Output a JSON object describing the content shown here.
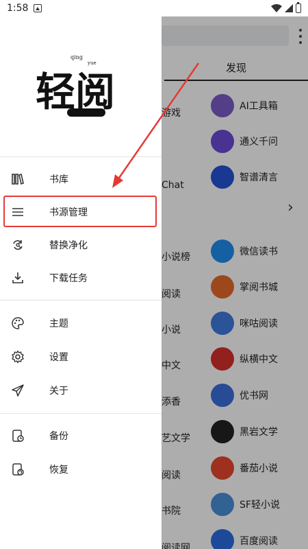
{
  "status_bar": {
    "time": "1:58"
  },
  "drawer": {
    "logo_alt": "轻阅",
    "menu_group_1": [
      {
        "label": "书库",
        "icon": "bookshelf-icon"
      },
      {
        "label": "书源管理",
        "icon": "list-icon"
      },
      {
        "label": "替换净化",
        "icon": "replace-icon"
      },
      {
        "label": "下载任务",
        "icon": "download-icon"
      }
    ],
    "menu_group_2": [
      {
        "label": "主题",
        "icon": "palette-icon"
      },
      {
        "label": "设置",
        "icon": "gear-icon"
      },
      {
        "label": "关于",
        "icon": "send-icon"
      }
    ],
    "menu_group_3": [
      {
        "label": "备份",
        "icon": "backup-icon"
      },
      {
        "label": "恢复",
        "icon": "restore-icon"
      }
    ]
  },
  "background": {
    "tab": "发现",
    "left_partial": [
      "游戏",
      "Chat",
      "小说榜",
      "阅读",
      "小说",
      "中文",
      "添香",
      "艺文学",
      "阅读",
      "书院",
      "阅读网"
    ],
    "right_items": [
      {
        "label": "AI工具箱",
        "color": "#7b5cc7"
      },
      {
        "label": "通义千问",
        "color": "#6a4bd8"
      },
      {
        "label": "智谱清言",
        "color": "#2453d6"
      },
      {
        "label": "微信读书",
        "color": "#1f8ef0"
      },
      {
        "label": "掌阅书城",
        "color": "#e86b2a"
      },
      {
        "label": "咪咕阅读",
        "color": "#3e7be0"
      },
      {
        "label": "纵横中文",
        "color": "#d8302c"
      },
      {
        "label": "优书网",
        "color": "#3c6fdc"
      },
      {
        "label": "黑岩文学",
        "color": "#222222"
      },
      {
        "label": "番茄小说",
        "color": "#e8472f"
      },
      {
        "label": "SF轻小说",
        "color": "#4a90d9"
      },
      {
        "label": "百度阅读",
        "color": "#2b6de0"
      }
    ]
  },
  "colors": {
    "highlight": "#e53935",
    "arrow": "#e53935"
  }
}
